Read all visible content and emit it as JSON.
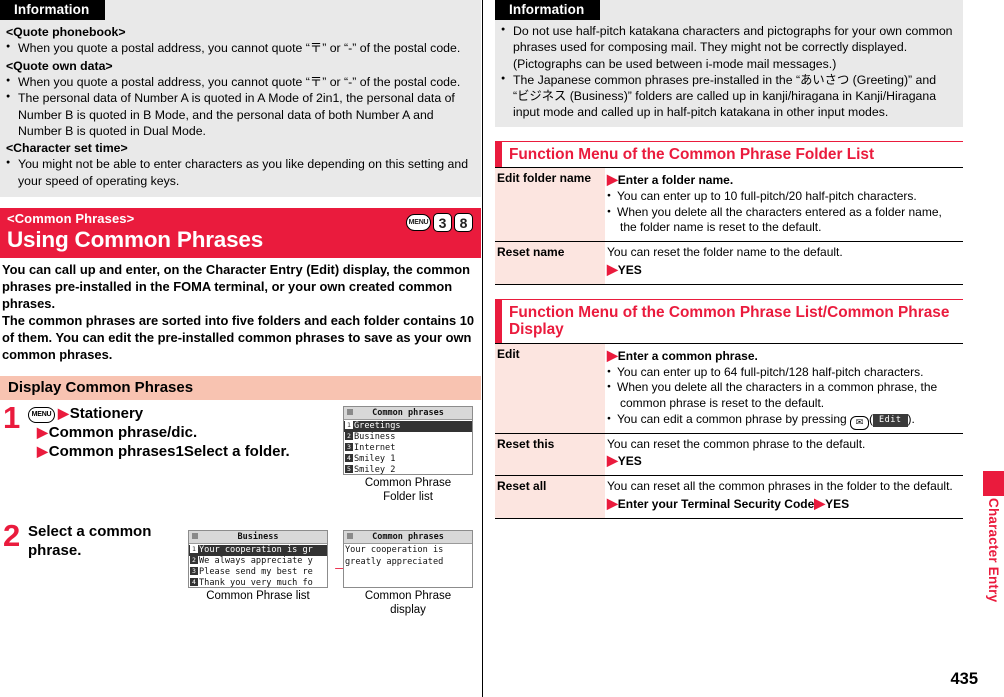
{
  "page": {
    "number": "435",
    "edge_tab_label": "Character Entry"
  },
  "left": {
    "information": {
      "tab_label": "Information",
      "groups": [
        {
          "heading": "<Quote phonebook>",
          "bullets": [
            "When you quote a postal address, you cannot quote “〒” or “-” of the postal code."
          ]
        },
        {
          "heading": "<Quote own data>",
          "bullets": [
            "When you quote a postal address, you cannot quote “〒” or “-” of the postal code.",
            "The personal data of Number A is quoted in A Mode of 2in1, the personal data of Number B is quoted in B Mode, and the personal data of both Number A and Number B is quoted in Dual Mode."
          ]
        },
        {
          "heading": "<Character set time>",
          "bullets": [
            "You might not be able to enter characters as you like depending on this setting and your speed of operating keys."
          ]
        }
      ]
    },
    "section": {
      "tag": "<Common Phrases>",
      "title": "Using Common Phrases",
      "keys": [
        "MENU",
        "3",
        "8"
      ],
      "intro": "You can call up and enter, on the Character Entry (Edit) display, the common phrases pre-installed in the FOMA terminal, or your own created common phrases.\nThe common phrases are sorted into five folders and each folder contains 10 of them. You can edit the pre-installed common phrases to save as your own common phrases."
    },
    "subsection": {
      "title": "Display Common Phrases",
      "steps": [
        {
          "number": "1",
          "key_icon": "MENU",
          "lines": [
            "Stationery",
            "Common phrase/dic.",
            "Common phrases1Select a folder."
          ],
          "screenshot": {
            "title": "Common phrases",
            "rows": [
              {
                "no": "1",
                "text": "Greetings",
                "selected": true
              },
              {
                "no": "2",
                "text": "Business",
                "selected": false
              },
              {
                "no": "3",
                "text": "Internet",
                "selected": false
              },
              {
                "no": "4",
                "text": "Smiley 1",
                "selected": false
              },
              {
                "no": "5",
                "text": "Smiley 2",
                "selected": false
              }
            ],
            "caption": "Common Phrase\nFolder list"
          }
        },
        {
          "number": "2",
          "lines": [
            "Select a common phrase."
          ],
          "screenshot_list": {
            "title": "Business",
            "rows": [
              {
                "no": "1",
                "text": "Your cooperation is gr",
                "selected": true
              },
              {
                "no": "2",
                "text": "We always appreciate y",
                "selected": false
              },
              {
                "no": "3",
                "text": "Please send my best re",
                "selected": false
              },
              {
                "no": "4",
                "text": "Thank you very much fo",
                "selected": false
              }
            ],
            "caption": "Common Phrase list"
          },
          "arrow": "→",
          "screenshot_display": {
            "title": "Common phrases",
            "text": "Your cooperation is greatly appreciated",
            "caption": "Common Phrase\ndisplay"
          }
        }
      ]
    }
  },
  "right": {
    "information": {
      "tab_label": "Information",
      "bullets": [
        "Do not use half-pitch katakana characters and pictographs for your own common phrases used for composing mail. They might not be correctly displayed. (Pictographs can be used between i-mode mail messages.)",
        "The Japanese common phrases pre-installed in the “あいさつ (Greeting)” and “ビジネス (Business)” folders are called up in kanji/hiragana in Kanji/Hiragana input mode and called up in half-pitch katakana in other input modes."
      ]
    },
    "sections": [
      {
        "title": "Function Menu of the Common Phrase Folder List",
        "rows": [
          {
            "label": "Edit folder name",
            "lead": "Enter a folder name.",
            "lead_arrow": true,
            "plain": "",
            "bullets": [
              {
                "text": "You can enter up to 10 full-pitch/20 half-pitch characters.",
                "sub": ""
              },
              {
                "text": "When you delete all the characters entered as a folder name,",
                "sub": "the folder name is reset to the default."
              }
            ],
            "trailer": ""
          },
          {
            "label": "Reset name",
            "lead": "",
            "lead_arrow": false,
            "plain": "You can reset the folder name to the default.",
            "bullets": [],
            "trailer": "YES"
          }
        ]
      },
      {
        "title": "Function Menu of the Common Phrase List/Common Phrase Display",
        "rows": [
          {
            "label": "Edit",
            "lead": "Enter a common phrase.",
            "lead_arrow": true,
            "plain": "",
            "bullets": [
              {
                "text": "You can enter up to 64 full-pitch/128 half-pitch characters.",
                "sub": ""
              },
              {
                "text": "When you delete all the characters in a common phrase, the",
                "sub": "common phrase is reset to the default."
              }
            ],
            "edit_note": {
              "prefix": "You can edit a common phrase by pressing ",
              "key": "✉",
              "button": "Edit",
              "suffix": ")."
            },
            "trailer": ""
          },
          {
            "label": "Reset this",
            "lead": "",
            "lead_arrow": false,
            "plain": "You can reset the common phrase to the default.",
            "bullets": [],
            "trailer": "YES"
          },
          {
            "label": "Reset all",
            "lead": "",
            "lead_arrow": false,
            "plain": "You can reset all the common phrases in the folder to the default.",
            "bullets": [],
            "trailer": "Enter your Terminal Security Code",
            "trailer2": "YES"
          }
        ]
      }
    ]
  },
  "colors": {
    "accent_red": "#ea1b3d",
    "pink_header": "#f8c3b1",
    "table_label_bg": "#fce5e0",
    "info_bg": "#e9e9e9"
  }
}
